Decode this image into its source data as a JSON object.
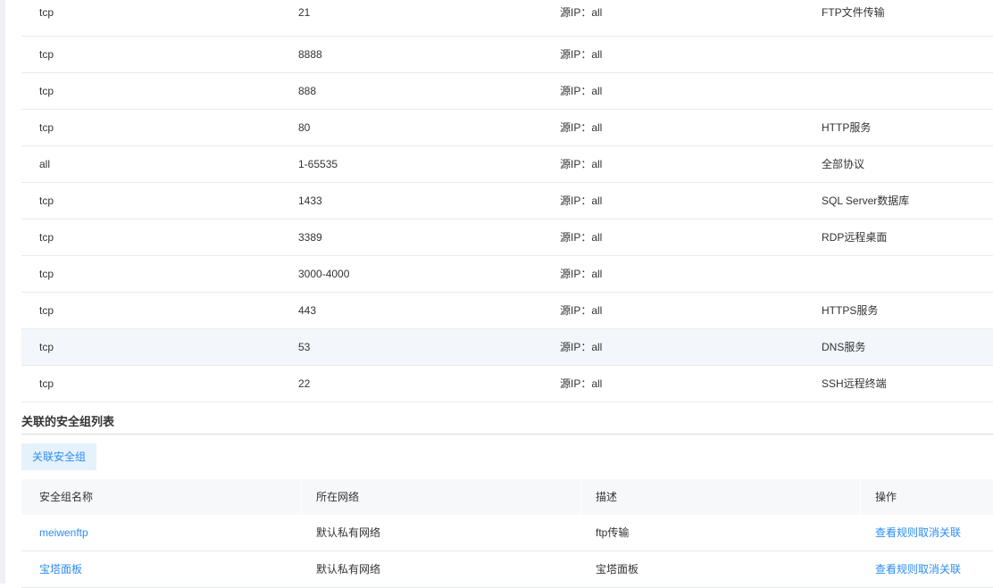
{
  "rules": [
    {
      "protocol": "tcp",
      "port": "21",
      "source": "源IP：all",
      "desc": "FTP文件传输"
    },
    {
      "protocol": "tcp",
      "port": "8888",
      "source": "源IP：all",
      "desc": ""
    },
    {
      "protocol": "tcp",
      "port": "888",
      "source": "源IP：all",
      "desc": ""
    },
    {
      "protocol": "tcp",
      "port": "80",
      "source": "源IP：all",
      "desc": "HTTP服务"
    },
    {
      "protocol": "all",
      "port": "1-65535",
      "source": "源IP：all",
      "desc": "全部协议"
    },
    {
      "protocol": "tcp",
      "port": "1433",
      "source": "源IP：all",
      "desc": "SQL Server数据库"
    },
    {
      "protocol": "tcp",
      "port": "3389",
      "source": "源IP：all",
      "desc": "RDP远程桌面"
    },
    {
      "protocol": "tcp",
      "port": "3000-4000",
      "source": "源IP：all",
      "desc": ""
    },
    {
      "protocol": "tcp",
      "port": "443",
      "source": "源IP：all",
      "desc": "HTTPS服务"
    },
    {
      "protocol": "tcp",
      "port": "53",
      "source": "源IP：all",
      "desc": "DNS服务"
    },
    {
      "protocol": "tcp",
      "port": "22",
      "source": "源IP：all",
      "desc": "SSH远程终端"
    }
  ],
  "section": {
    "title": "关联的安全组列表",
    "associate_button": "关联安全组"
  },
  "groups_table": {
    "headers": [
      "安全组名称",
      "所在网络",
      "描述",
      "操作"
    ],
    "rows": [
      {
        "name": "meiwenftp",
        "network": "默认私有网络",
        "desc": "ftp传输",
        "view": "查看规则",
        "unlink": "取消关联"
      },
      {
        "name": "宝塔面板",
        "network": "默认私有网络",
        "desc": "宝塔面板",
        "view": "查看规则",
        "unlink": "取消关联"
      }
    ]
  },
  "colors": {
    "link": "#2d8cf0",
    "button_bg": "#e5f2fc",
    "header_bg": "#f7f8fa",
    "highlight_row": "#f3f7fb"
  }
}
